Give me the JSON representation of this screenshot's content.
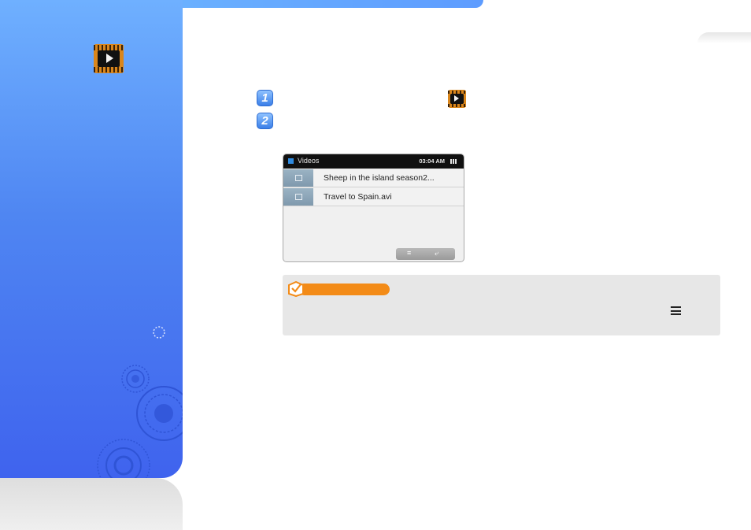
{
  "left_panel": {
    "icon": "film-icon"
  },
  "steps": [
    {
      "number": "1"
    },
    {
      "number": "2"
    }
  ],
  "device": {
    "header_title": "Videos",
    "time": "03:04 AM",
    "battery_icon": "battery-icon",
    "files": [
      {
        "name": "Sheep in the island season2..."
      },
      {
        "name": "Travel to Spain.avi"
      }
    ],
    "buttons": [
      {
        "icon": "menu-icon",
        "glyph": "≡"
      },
      {
        "icon": "back-icon",
        "glyph": "⤶"
      }
    ]
  },
  "note": {
    "icon": "checkbox-note-icon",
    "menu_icon": "menu-icon"
  },
  "colors": {
    "panel_blue": "#4f86f2",
    "note_orange": "#f38b17",
    "step_blue": "#3b7fe8"
  }
}
